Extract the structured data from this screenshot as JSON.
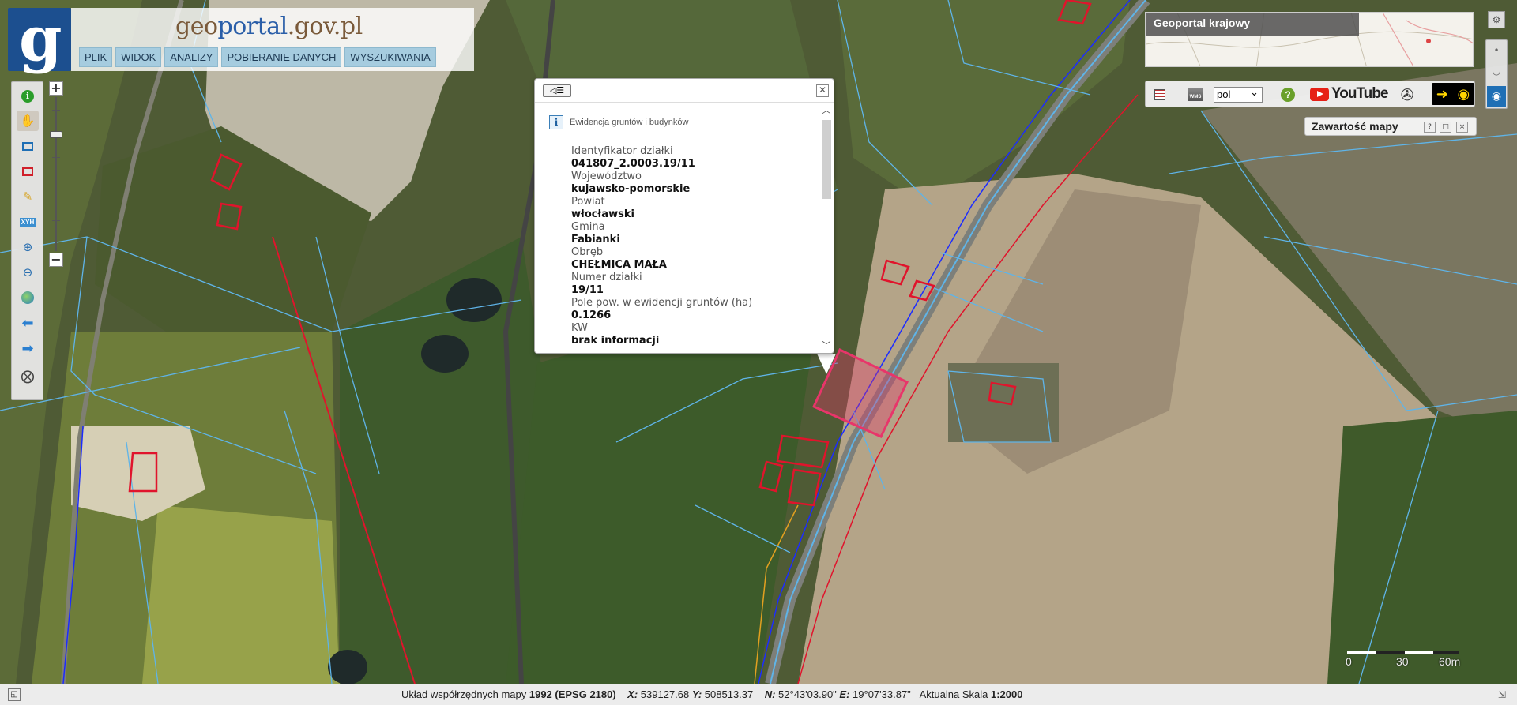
{
  "app": {
    "site_title_prefix": "geo",
    "site_title_highlight": "portal",
    "site_title_suffix": ".gov.pl",
    "logo_letter": "g"
  },
  "menu": {
    "items": [
      "PLIK",
      "WIDOK",
      "ANALIZY",
      "POBIERANIE DANYCH",
      "WYSZUKIWANIA"
    ]
  },
  "toolbar": {
    "icons": [
      "info-icon",
      "pan-hand-icon",
      "select-rect-icon",
      "select-red-icon",
      "pencil-icon",
      "xyh-icon",
      "zoom-in-icon",
      "zoom-out-icon",
      "globe-icon",
      "back-arrow-icon",
      "forward-arrow-icon",
      "crosshair-icon"
    ],
    "xyh_label": "XYH"
  },
  "zoom": {
    "plus": "+",
    "minus": "−"
  },
  "popup": {
    "layer_name": "Ewidencja gruntów i budynków",
    "fields": [
      {
        "label": "Identyfikator działki",
        "value": "041807_2.0003.19/11"
      },
      {
        "label": "Województwo",
        "value": "kujawsko-pomorskie"
      },
      {
        "label": "Powiat",
        "value": "włocławski"
      },
      {
        "label": "Gmina",
        "value": "Fabianki"
      },
      {
        "label": "Obręb",
        "value": "CHEŁMICA MAŁA"
      },
      {
        "label": "Numer działki",
        "value": "19/11"
      },
      {
        "label": "Pole pow. w ewidencji gruntów (ha)",
        "value": "0.1266"
      },
      {
        "label": "KW",
        "value": "brak informacji"
      }
    ]
  },
  "overview": {
    "title": "Geoportal krajowy"
  },
  "topbar": {
    "language": "pol",
    "youtube_label": "YouTube",
    "help_icon": "help-icon",
    "eye_icon": "eye-icon"
  },
  "map_contents": {
    "label": "Zawartość mapy",
    "buttons": [
      "?",
      "□",
      "×"
    ]
  },
  "scale": {
    "labels": [
      "0",
      "30",
      "60m"
    ]
  },
  "status": {
    "coord_label": "Układ współrzędnych mapy",
    "coord_system": "1992 (EPSG 2180)",
    "x_label": "X:",
    "x_value": "539127.68",
    "y_label": "Y:",
    "y_value": "508513.37",
    "n_label": "N:",
    "n_value": "52°43'03.90\"",
    "e_label": "E:",
    "e_value": "19°07'33.87\"",
    "scale_label": "Aktualna Skala",
    "scale_value": "1:2000"
  },
  "colors": {
    "parcel_lines": "#5fb4e8",
    "buildings": "#e0142c",
    "selected_parcel": "#e8356a",
    "road_line": "#1c2cff",
    "logo_bg": "#1c4f8f"
  }
}
